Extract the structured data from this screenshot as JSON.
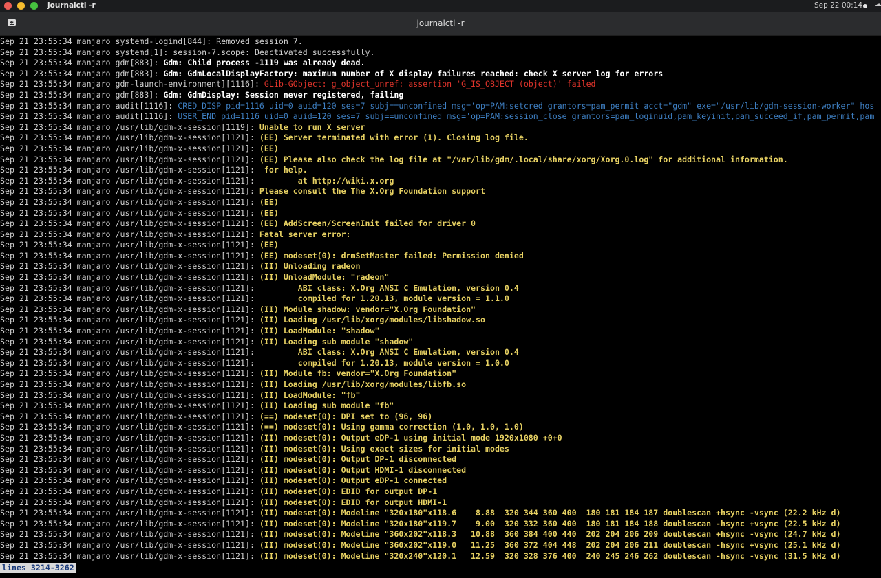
{
  "topbar": {
    "app_name": "journalctl -r",
    "clock": "Sep 22  00:14",
    "sys_icon": "☁"
  },
  "window": {
    "title": "journalctl -r"
  },
  "pager": {
    "status": "lines 3214-3262"
  },
  "colors": {
    "red": "#e0342b",
    "blue": "#3e7fc2",
    "yellow": "#e6d062",
    "white": "#ffffff",
    "gray": "#cfcfcf"
  },
  "log_lines": [
    {
      "prefix": "Sep 21 23:55:34 manjaro systemd-logind[844]: ",
      "msg": "Removed session 7.",
      "style": "plain"
    },
    {
      "prefix": "Sep 21 23:55:34 manjaro systemd[1]: ",
      "msg": "session-7.scope: Deactivated successfully.",
      "style": "plain"
    },
    {
      "prefix": "Sep 21 23:55:34 manjaro gdm[883]: ",
      "msg": "Gdm: Child process -1119 was already dead.",
      "style": "bold"
    },
    {
      "prefix": "Sep 21 23:55:34 manjaro gdm[883]: ",
      "msg": "Gdm: GdmLocalDisplayFactory: maximum number of X display failures reached: check X server log for errors",
      "style": "bold"
    },
    {
      "prefix": "Sep 21 23:55:34 manjaro gdm-launch-environment][1116]: ",
      "msg": "GLib-GObject: g_object_unref: assertion 'G_IS_OBJECT (object)' failed",
      "style": "red"
    },
    {
      "prefix": "Sep 21 23:55:34 manjaro gdm[883]: ",
      "msg": "Gdm: GdmDisplay: Session never registered, failing",
      "style": "bold"
    },
    {
      "prefix": "Sep 21 23:55:34 manjaro audit[1116]: ",
      "msg": "CRED_DISP pid=1116 uid=0 auid=120 ses=7 subj==unconfined msg='op=PAM:setcred grantors=pam_permit acct=\"gdm\" exe=\"/usr/lib/gdm-session-worker\" hos",
      "style": "blue"
    },
    {
      "prefix": "Sep 21 23:55:34 manjaro audit[1116]: ",
      "msg": "USER_END pid=1116 uid=0 auid=120 ses=7 subj==unconfined msg='op=PAM:session_close grantors=pam_loginuid,pam_keyinit,pam_succeed_if,pam_permit,pam",
      "style": "blue"
    },
    {
      "prefix": "Sep 21 23:55:34 manjaro /usr/lib/gdm-x-session[1119]: ",
      "msg": "Unable to run X server",
      "style": "yellow"
    },
    {
      "prefix": "Sep 21 23:55:34 manjaro /usr/lib/gdm-x-session[1121]: ",
      "msg": "(EE) Server terminated with error (1). Closing log file.",
      "style": "yellow"
    },
    {
      "prefix": "Sep 21 23:55:34 manjaro /usr/lib/gdm-x-session[1121]: ",
      "msg": "(EE)",
      "style": "yellow"
    },
    {
      "prefix": "Sep 21 23:55:34 manjaro /usr/lib/gdm-x-session[1121]: ",
      "msg": "(EE) Please also check the log file at \"/var/lib/gdm/.local/share/xorg/Xorg.0.log\" for additional information.",
      "style": "yellow"
    },
    {
      "prefix": "Sep 21 23:55:34 manjaro /usr/lib/gdm-x-session[1121]: ",
      "msg": " for help.",
      "style": "yellow"
    },
    {
      "prefix": "Sep 21 23:55:34 manjaro /usr/lib/gdm-x-session[1121]: ",
      "msg": "        at http://wiki.x.org",
      "style": "yellow"
    },
    {
      "prefix": "Sep 21 23:55:34 manjaro /usr/lib/gdm-x-session[1121]: ",
      "msg": "Please consult the The X.Org Foundation support",
      "style": "yellow"
    },
    {
      "prefix": "Sep 21 23:55:34 manjaro /usr/lib/gdm-x-session[1121]: ",
      "msg": "(EE)",
      "style": "yellow"
    },
    {
      "prefix": "Sep 21 23:55:34 manjaro /usr/lib/gdm-x-session[1121]: ",
      "msg": "(EE)",
      "style": "yellow"
    },
    {
      "prefix": "Sep 21 23:55:34 manjaro /usr/lib/gdm-x-session[1121]: ",
      "msg": "(EE) AddScreen/ScreenInit failed for driver 0",
      "style": "yellow"
    },
    {
      "prefix": "Sep 21 23:55:34 manjaro /usr/lib/gdm-x-session[1121]: ",
      "msg": "Fatal server error:",
      "style": "yellow"
    },
    {
      "prefix": "Sep 21 23:55:34 manjaro /usr/lib/gdm-x-session[1121]: ",
      "msg": "(EE)",
      "style": "yellow"
    },
    {
      "prefix": "Sep 21 23:55:34 manjaro /usr/lib/gdm-x-session[1121]: ",
      "msg": "(EE) modeset(0): drmSetMaster failed: Permission denied",
      "style": "yellow"
    },
    {
      "prefix": "Sep 21 23:55:34 manjaro /usr/lib/gdm-x-session[1121]: ",
      "msg": "(II) Unloading radeon",
      "style": "yellow"
    },
    {
      "prefix": "Sep 21 23:55:34 manjaro /usr/lib/gdm-x-session[1121]: ",
      "msg": "(II) UnloadModule: \"radeon\"",
      "style": "yellow"
    },
    {
      "prefix": "Sep 21 23:55:34 manjaro /usr/lib/gdm-x-session[1121]: ",
      "msg": "        ABI class: X.Org ANSI C Emulation, version 0.4",
      "style": "yellow"
    },
    {
      "prefix": "Sep 21 23:55:34 manjaro /usr/lib/gdm-x-session[1121]: ",
      "msg": "        compiled for 1.20.13, module version = 1.1.0",
      "style": "yellow"
    },
    {
      "prefix": "Sep 21 23:55:34 manjaro /usr/lib/gdm-x-session[1121]: ",
      "msg": "(II) Module shadow: vendor=\"X.Org Foundation\"",
      "style": "yellow"
    },
    {
      "prefix": "Sep 21 23:55:34 manjaro /usr/lib/gdm-x-session[1121]: ",
      "msg": "(II) Loading /usr/lib/xorg/modules/libshadow.so",
      "style": "yellow"
    },
    {
      "prefix": "Sep 21 23:55:34 manjaro /usr/lib/gdm-x-session[1121]: ",
      "msg": "(II) LoadModule: \"shadow\"",
      "style": "yellow"
    },
    {
      "prefix": "Sep 21 23:55:34 manjaro /usr/lib/gdm-x-session[1121]: ",
      "msg": "(II) Loading sub module \"shadow\"",
      "style": "yellow"
    },
    {
      "prefix": "Sep 21 23:55:34 manjaro /usr/lib/gdm-x-session[1121]: ",
      "msg": "        ABI class: X.Org ANSI C Emulation, version 0.4",
      "style": "yellow"
    },
    {
      "prefix": "Sep 21 23:55:34 manjaro /usr/lib/gdm-x-session[1121]: ",
      "msg": "        compiled for 1.20.13, module version = 1.0.0",
      "style": "yellow"
    },
    {
      "prefix": "Sep 21 23:55:34 manjaro /usr/lib/gdm-x-session[1121]: ",
      "msg": "(II) Module fb: vendor=\"X.Org Foundation\"",
      "style": "yellow"
    },
    {
      "prefix": "Sep 21 23:55:34 manjaro /usr/lib/gdm-x-session[1121]: ",
      "msg": "(II) Loading /usr/lib/xorg/modules/libfb.so",
      "style": "yellow"
    },
    {
      "prefix": "Sep 21 23:55:34 manjaro /usr/lib/gdm-x-session[1121]: ",
      "msg": "(II) LoadModule: \"fb\"",
      "style": "yellow"
    },
    {
      "prefix": "Sep 21 23:55:34 manjaro /usr/lib/gdm-x-session[1121]: ",
      "msg": "(II) Loading sub module \"fb\"",
      "style": "yellow"
    },
    {
      "prefix": "Sep 21 23:55:34 manjaro /usr/lib/gdm-x-session[1121]: ",
      "msg": "(==) modeset(0): DPI set to (96, 96)",
      "style": "yellow"
    },
    {
      "prefix": "Sep 21 23:55:34 manjaro /usr/lib/gdm-x-session[1121]: ",
      "msg": "(==) modeset(0): Using gamma correction (1.0, 1.0, 1.0)",
      "style": "yellow"
    },
    {
      "prefix": "Sep 21 23:55:34 manjaro /usr/lib/gdm-x-session[1121]: ",
      "msg": "(II) modeset(0): Output eDP-1 using initial mode 1920x1080 +0+0",
      "style": "yellow"
    },
    {
      "prefix": "Sep 21 23:55:34 manjaro /usr/lib/gdm-x-session[1121]: ",
      "msg": "(II) modeset(0): Using exact sizes for initial modes",
      "style": "yellow"
    },
    {
      "prefix": "Sep 21 23:55:34 manjaro /usr/lib/gdm-x-session[1121]: ",
      "msg": "(II) modeset(0): Output DP-1 disconnected",
      "style": "yellow"
    },
    {
      "prefix": "Sep 21 23:55:34 manjaro /usr/lib/gdm-x-session[1121]: ",
      "msg": "(II) modeset(0): Output HDMI-1 disconnected",
      "style": "yellow"
    },
    {
      "prefix": "Sep 21 23:55:34 manjaro /usr/lib/gdm-x-session[1121]: ",
      "msg": "(II) modeset(0): Output eDP-1 connected",
      "style": "yellow"
    },
    {
      "prefix": "Sep 21 23:55:34 manjaro /usr/lib/gdm-x-session[1121]: ",
      "msg": "(II) modeset(0): EDID for output DP-1",
      "style": "yellow"
    },
    {
      "prefix": "Sep 21 23:55:34 manjaro /usr/lib/gdm-x-session[1121]: ",
      "msg": "(II) modeset(0): EDID for output HDMI-1",
      "style": "yellow"
    },
    {
      "prefix": "Sep 21 23:55:34 manjaro /usr/lib/gdm-x-session[1121]: ",
      "msg": "(II) modeset(0): Modeline \"320x180\"x118.6    8.88  320 344 360 400  180 181 184 187 doublescan +hsync -vsync (22.2 kHz d)",
      "style": "yellow"
    },
    {
      "prefix": "Sep 21 23:55:34 manjaro /usr/lib/gdm-x-session[1121]: ",
      "msg": "(II) modeset(0): Modeline \"320x180\"x119.7    9.00  320 332 360 400  180 181 184 188 doublescan -hsync +vsync (22.5 kHz d)",
      "style": "yellow"
    },
    {
      "prefix": "Sep 21 23:55:34 manjaro /usr/lib/gdm-x-session[1121]: ",
      "msg": "(II) modeset(0): Modeline \"360x202\"x118.3   10.88  360 384 400 440  202 204 206 209 doublescan +hsync -vsync (24.7 kHz d)",
      "style": "yellow"
    },
    {
      "prefix": "Sep 21 23:55:34 manjaro /usr/lib/gdm-x-session[1121]: ",
      "msg": "(II) modeset(0): Modeline \"360x202\"x119.0   11.25  360 372 404 448  202 204 206 211 doublescan -hsync +vsync (25.1 kHz d)",
      "style": "yellow"
    },
    {
      "prefix": "Sep 21 23:55:34 manjaro /usr/lib/gdm-x-session[1121]: ",
      "msg": "(II) modeset(0): Modeline \"320x240\"x120.1   12.59  320 328 376 400  240 245 246 262 doublescan -hsync -vsync (31.5 kHz d)",
      "style": "yellow"
    }
  ]
}
